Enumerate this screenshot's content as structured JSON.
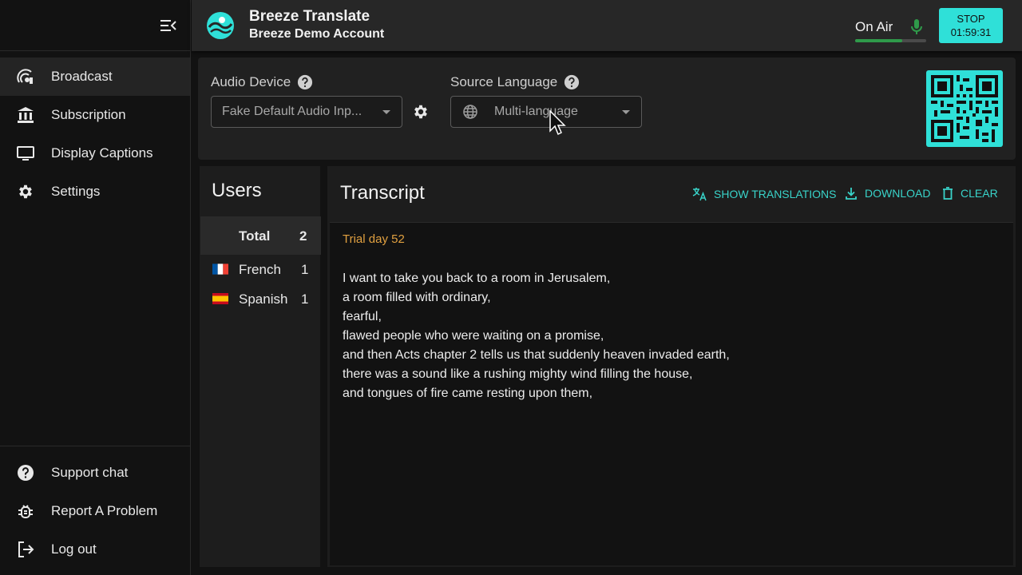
{
  "app": {
    "title": "Breeze Translate",
    "account": "Breeze Demo Account",
    "brand_color": "#2fe0d8"
  },
  "header": {
    "status_label": "On Air",
    "mic_level": 0.66,
    "stop_label": "STOP",
    "stop_timer": "01:59:31"
  },
  "sidebar": {
    "main_items": [
      {
        "label": "Broadcast",
        "icon": "broadcast-icon",
        "active": true
      },
      {
        "label": "Subscription",
        "icon": "bank-icon",
        "active": false
      },
      {
        "label": "Display Captions",
        "icon": "monitor-icon",
        "active": false
      },
      {
        "label": "Settings",
        "icon": "gear-icon",
        "active": false
      }
    ],
    "bottom_items": [
      {
        "label": "Support chat",
        "icon": "help-icon"
      },
      {
        "label": "Report A Problem",
        "icon": "bug-icon"
      },
      {
        "label": "Log out",
        "icon": "logout-icon"
      }
    ]
  },
  "controls": {
    "audio_device_label": "Audio Device",
    "audio_device_value": "Fake Default Audio Inp...",
    "source_language_label": "Source Language",
    "source_language_value": "Multi-language"
  },
  "users": {
    "title": "Users",
    "total_label": "Total",
    "total_count": "2",
    "rows": [
      {
        "language": "French",
        "count": "1",
        "flag": "france-flag"
      },
      {
        "language": "Spanish",
        "count": "1",
        "flag": "spain-flag"
      }
    ]
  },
  "transcript": {
    "title": "Transcript",
    "show_translations_label": "SHOW TRANSLATIONS",
    "download_label": "DOWNLOAD",
    "clear_label": "CLEAR",
    "trial_notice": "Trial day 52",
    "lines": [
      "I want to take you back to a room in Jerusalem,",
      "a room filled with ordinary,",
      "fearful,",
      "flawed people who were waiting on a promise,",
      "and then Acts chapter 2 tells us that suddenly heaven invaded earth,",
      "there was a sound like a rushing mighty wind filling the house,",
      "and tongues of fire came resting upon them,"
    ]
  }
}
